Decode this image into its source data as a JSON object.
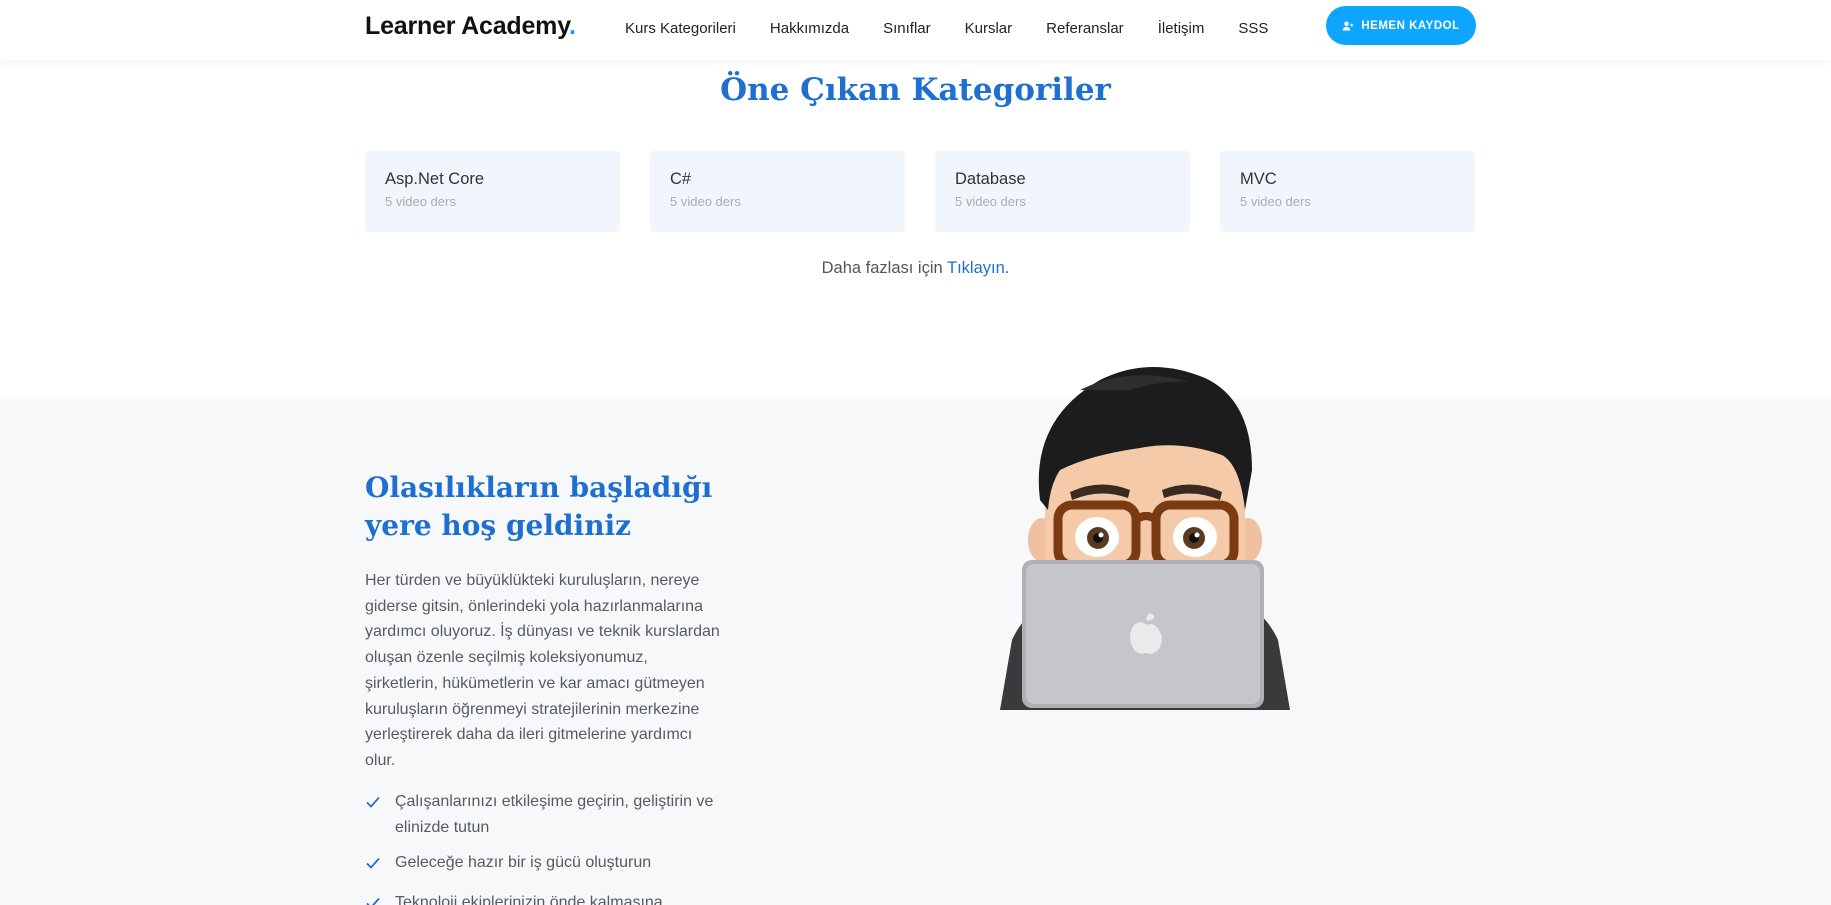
{
  "header": {
    "logo": "Learner Academy",
    "logo_dot": ".",
    "nav": [
      "Kurs Kategorileri",
      "Hakkımızda",
      "Sınıflar",
      "Kurslar",
      "Referanslar",
      "İletişim",
      "SSS"
    ],
    "cta_label": "HEMEN KAYDOL",
    "accent": "#0ea5ff"
  },
  "featured": {
    "title": "Öne Çıkan Kategoriler",
    "categories": [
      {
        "name": "Asp.Net Core",
        "count": "5 video ders"
      },
      {
        "name": "C#",
        "count": "5 video ders"
      },
      {
        "name": "Database",
        "count": "5 video ders"
      },
      {
        "name": "MVC",
        "count": "5 video ders"
      }
    ],
    "more_prefix": "Daha fazlası için ",
    "more_link": "Tıklayın",
    "more_suffix": "."
  },
  "welcome": {
    "title": "Olasılıkların başladığı yere hoş geldiniz",
    "text": "Her türden ve büyüklükteki kuruluşların, nereye giderse gitsin, önlerindeki yola hazırlanmalarına yardımcı oluyoruz. İş dünyası ve teknik kurslardan oluşan özenle seçilmiş koleksiyonumuz, şirketlerin, hükümetlerin ve kar amacı gütmeyen kuruluşların öğrenmeyi stratejilerinin merkezine yerleştirerek daha da ileri gitmelerine yardımcı olur.",
    "list": [
      "Çalışanlarınızı etkileşime geçirin, geliştirin ve elinizde tutun",
      "Geleceğe hazır bir iş gücü oluşturun",
      "Teknoloji ekiplerinizin önde kalmasına"
    ],
    "illustration": "memoji-with-laptop"
  },
  "colors": {
    "title_blue": "#1e6fcf",
    "card_bg": "#f1f5fc",
    "section_bg": "#f7f8fa"
  }
}
